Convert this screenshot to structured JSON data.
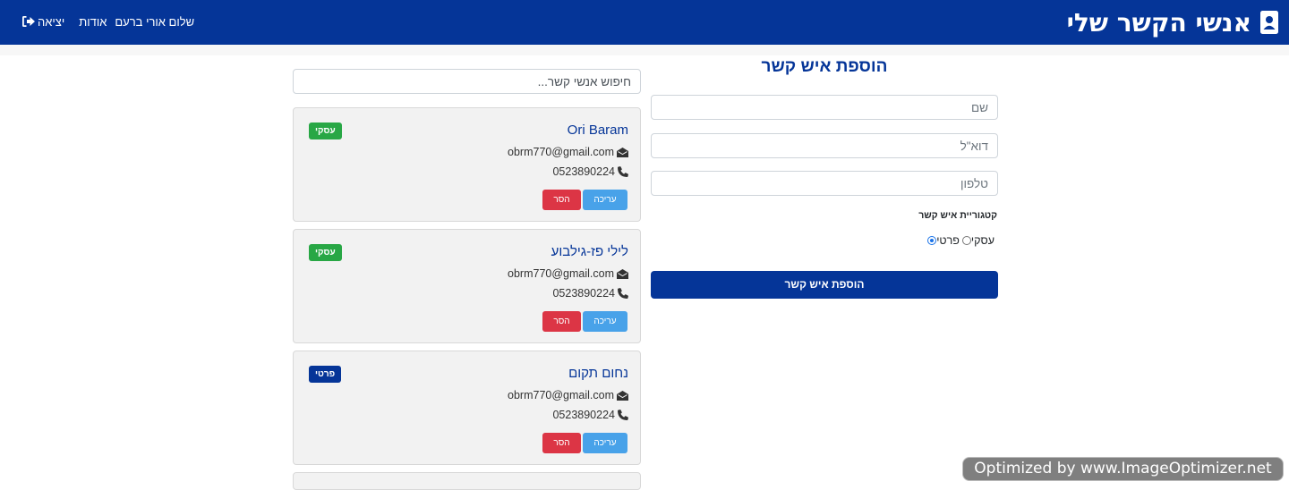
{
  "header": {
    "title": "אנשי הקשר שלי",
    "brand_icon": "contact-card-icon",
    "greeting": "שלום אורי ברעם",
    "about_label": "אודות",
    "logout_label": "יציאה",
    "logout_icon": "sign-out-icon",
    "bar_color": "#053598"
  },
  "form": {
    "title": "הוספת איש קשר",
    "name_placeholder": "שם",
    "email_placeholder": "דוא\"ל",
    "phone_placeholder": "טלפון",
    "category_label": "קטגוריית איש קשר",
    "category_options": [
      {
        "label": "פרטי",
        "selected": true
      },
      {
        "label": "עסקי",
        "selected": false
      }
    ],
    "submit_label": "הוספת איש קשר"
  },
  "contacts": {
    "search_placeholder": "חיפוש אנשי קשר...",
    "items": [
      {
        "name": "Ori Baram",
        "email": "obrm770@gmail.com",
        "phone": "0523890224",
        "category": "עסקי",
        "category_color": "#28a745",
        "edit_label": "עריכה",
        "remove_label": "הסר"
      },
      {
        "name": "לילי פז-גילבוע",
        "email": "obrm770@gmail.com",
        "phone": "0523890224",
        "category": "עסקי",
        "category_color": "#28a745",
        "edit_label": "עריכה",
        "remove_label": "הסר"
      },
      {
        "name": "נחום תקום",
        "email": "obrm770@gmail.com",
        "phone": "0523890224",
        "category": "פרטי",
        "category_color": "#053598",
        "edit_label": "עריכה",
        "remove_label": "הסר"
      }
    ]
  },
  "watermark": "Optimized by www.ImageOptimizer.net"
}
